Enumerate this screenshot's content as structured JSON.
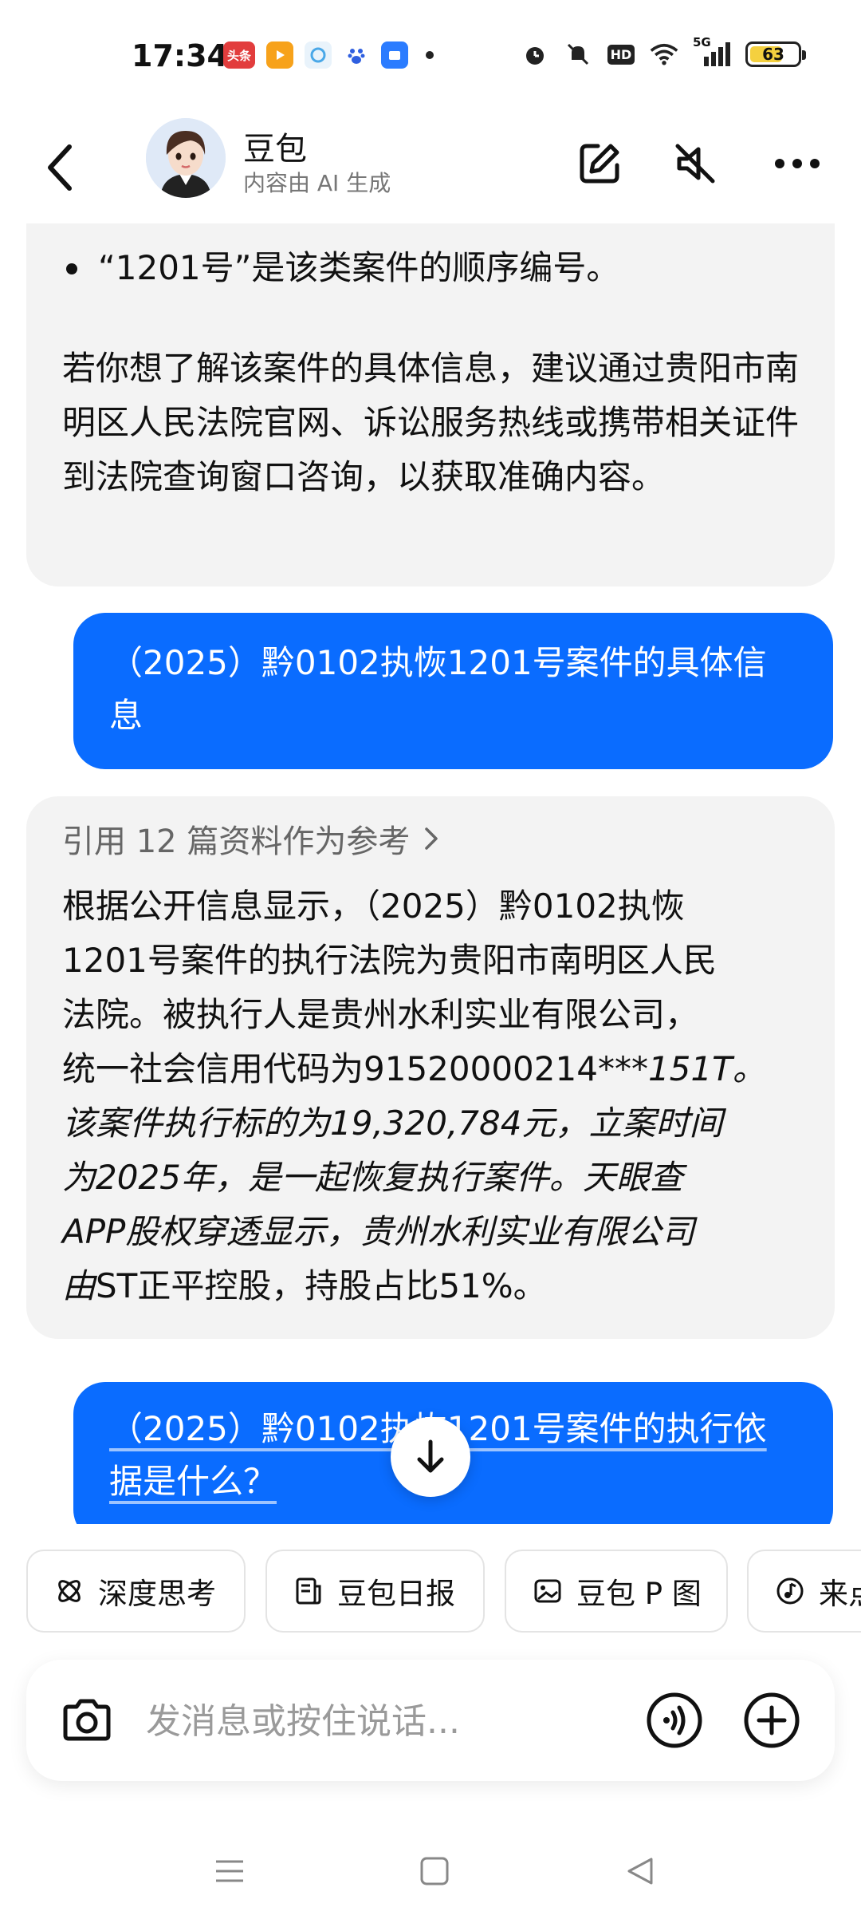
{
  "status_bar": {
    "time": "17:34",
    "battery": "63",
    "battery_level": 0.63,
    "network": "5G",
    "apps": [
      {
        "icon": "toutiao-icon",
        "label": "头条",
        "color": "#e23d3d"
      },
      {
        "icon": "video-app-icon",
        "label": "",
        "color": "#f7a21b"
      },
      {
        "icon": "browser-app-icon",
        "label": "",
        "color": "#4aa8e8"
      },
      {
        "icon": "baidu-icon",
        "label": "",
        "color": "#2f5fe0"
      },
      {
        "icon": "app-store-icon",
        "label": "",
        "color": "#2b7cff"
      }
    ]
  },
  "header": {
    "name": "豆包",
    "subtitle": "内容由 AI 生成"
  },
  "messages": {
    "ai1": {
      "bullet": "“1201号”是该类案件的顺序编号。",
      "paragraph": "若你想了解该案件的具体信息，建议通过贵阳市南明区人民法院官网、诉讼服务热线或携带相关证件到法院查询窗口咨询，以获取准确内容。"
    },
    "user1": "（2025）黔0102执恢1201号案件的具体信息",
    "ai2": {
      "reference": "引用 12 篇资料作为参考",
      "lines": [
        "根据公开信息显示，（2025）黔0102执恢",
        "1201号案件的执行法院为贵阳市南明区人民",
        "法院。被执行人是贵州水利实业有限公司，",
        "统一社会信用代码为91520000214***"
      ],
      "italic_tail": "151T。",
      "italic_lines": [
        "该案件执行标的为19,320,784元，立案时间",
        "为2025年，是一起恢复执行案件。天眼查",
        "APP股权穿透显示，贵州水利实业有限公司"
      ],
      "last_italic": "由",
      "last_normal": "ST正平控股，持股占比51%。"
    },
    "user2": "（2025）黔0102执恢1201号案件的执行依据是什么？"
  },
  "quick_actions": [
    {
      "icon": "deep-think-icon",
      "label": "深度思考"
    },
    {
      "icon": "daily-report-icon",
      "label": "豆包日报"
    },
    {
      "icon": "image-edit-icon",
      "label": "豆包 P 图"
    },
    {
      "icon": "music-icon",
      "label": "来点"
    }
  ],
  "input": {
    "placeholder": "发消息或按住说话..."
  },
  "colors": {
    "accent": "#0a6cff",
    "ai_bubble": "#f3f3f3"
  }
}
